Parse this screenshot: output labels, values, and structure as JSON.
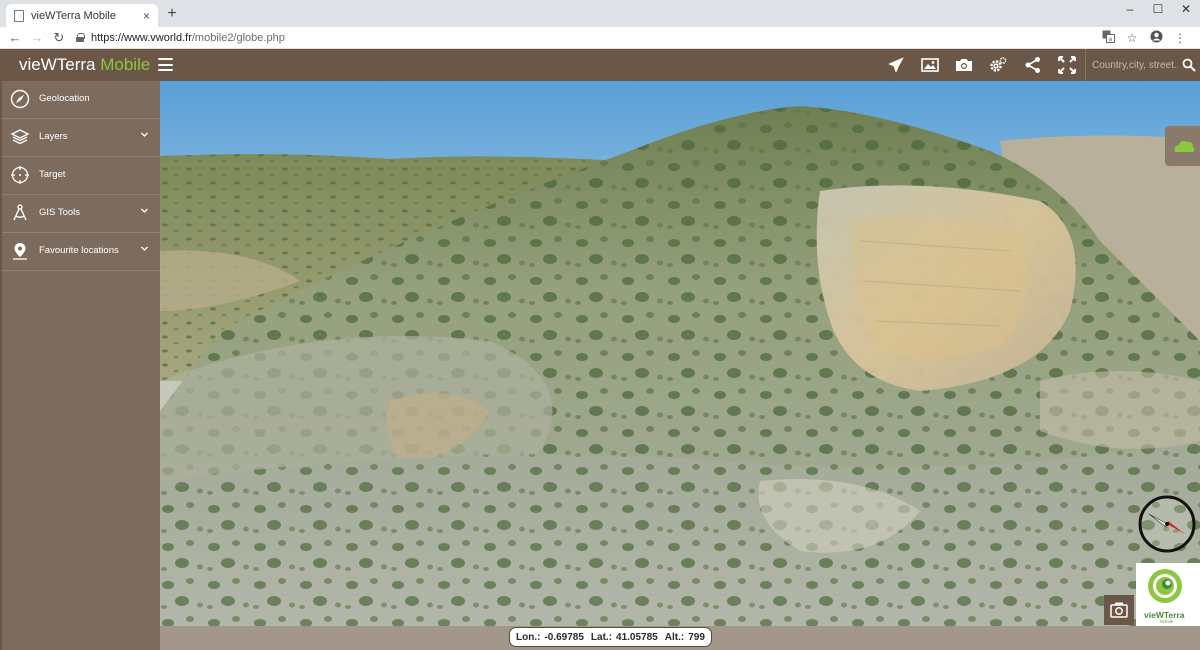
{
  "browser": {
    "tab_title": "vieWTerra Mobile",
    "tab_close": "×",
    "new_tab": "+",
    "url_domain": "https://www.vworld.fr",
    "url_path": "/mobile2/globe.php",
    "window_controls": [
      "–",
      "☐",
      "✕"
    ]
  },
  "app": {
    "brand_main": "vieWTerra ",
    "brand_accent": "Mobile",
    "accent_color": "#8dc63f",
    "header_color": "#6b5747",
    "toolbar": [
      "airplane-icon",
      "image-icon",
      "camera-icon",
      "settings-icon",
      "share-icon",
      "fullscreen-icon"
    ],
    "search_placeholder": "Country,city, street..."
  },
  "sidebar": {
    "items": [
      {
        "label": "Geolocation",
        "icon": "compass-icon",
        "expandable": false
      },
      {
        "label": "Layers",
        "icon": "layers-icon",
        "expandable": true
      },
      {
        "label": "Target",
        "icon": "crosshair-icon",
        "expandable": false
      },
      {
        "label": "GIS Tools",
        "icon": "compass-tool-icon",
        "expandable": true
      },
      {
        "label": "Favourite locations",
        "icon": "map-pin-icon",
        "expandable": true
      }
    ]
  },
  "status": {
    "lon_label": "Lon.:",
    "lon_value": "-0.69785",
    "lat_label": "Lat.:",
    "lat_value": "41.05785",
    "alt_label": "Alt.:",
    "alt_value": "799"
  },
  "logo": {
    "name": "vieWTerra",
    "sub": "Mobile"
  }
}
